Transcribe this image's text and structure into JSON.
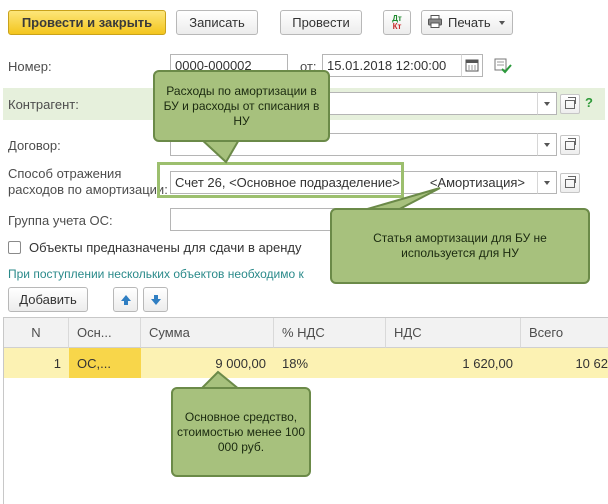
{
  "toolbar": {
    "post_close": "Провести и закрыть",
    "save": "Записать",
    "post": "Провести",
    "dt_kt_top": "Дт",
    "dt_kt_bottom": "Кт",
    "print": "Печать"
  },
  "form": {
    "number_label": "Номер:",
    "number_value": "0000-000002",
    "date_label": "от:",
    "date_value": "15.01.2018 12:00:00",
    "counterparty_label": "Контрагент:",
    "counterparty_value": "",
    "help": "?",
    "contract_label": "Договор:",
    "contract_value": "",
    "method_label_line1": "Способ отражения",
    "method_label_line2": "расходов по амортизации:",
    "method_value": "Счет 26, <Основное подразделение>",
    "method_value_extra": "<Амортизация>",
    "group_label": "Группа учета ОС:",
    "group_value": "",
    "rent_checkbox_label": "Объекты предназначены для сдачи в аренду",
    "rent_checked": false,
    "hint_text": "При поступлении нескольких объектов необходимо к"
  },
  "table_toolbar": {
    "add": "Добавить"
  },
  "table": {
    "headers": [
      "N",
      "Осн...",
      "Сумма",
      "% НДС",
      "НДС",
      "Всего"
    ],
    "rows": [
      {
        "n": "1",
        "os": "ОС,...",
        "sum": "9 000,00",
        "vat_rate": "18%",
        "vat": "1 620,00",
        "total": "10 62"
      }
    ]
  },
  "callouts": {
    "top": "Расходы по амортизации в БУ и расходы от списания в НУ",
    "right": "Статья амортизации для БУ не используется для НУ",
    "bottom": "Основное средство, стоимостью менее 100 000 руб."
  },
  "colors": {
    "primary_button": "#f3c51d",
    "callout_fill": "#a7c17d",
    "callout_border": "#6b8a48",
    "highlight_row": "#fcf2b3",
    "counterparty_band": "#e6f0dc",
    "accent_blue": "#2f7ec2"
  }
}
